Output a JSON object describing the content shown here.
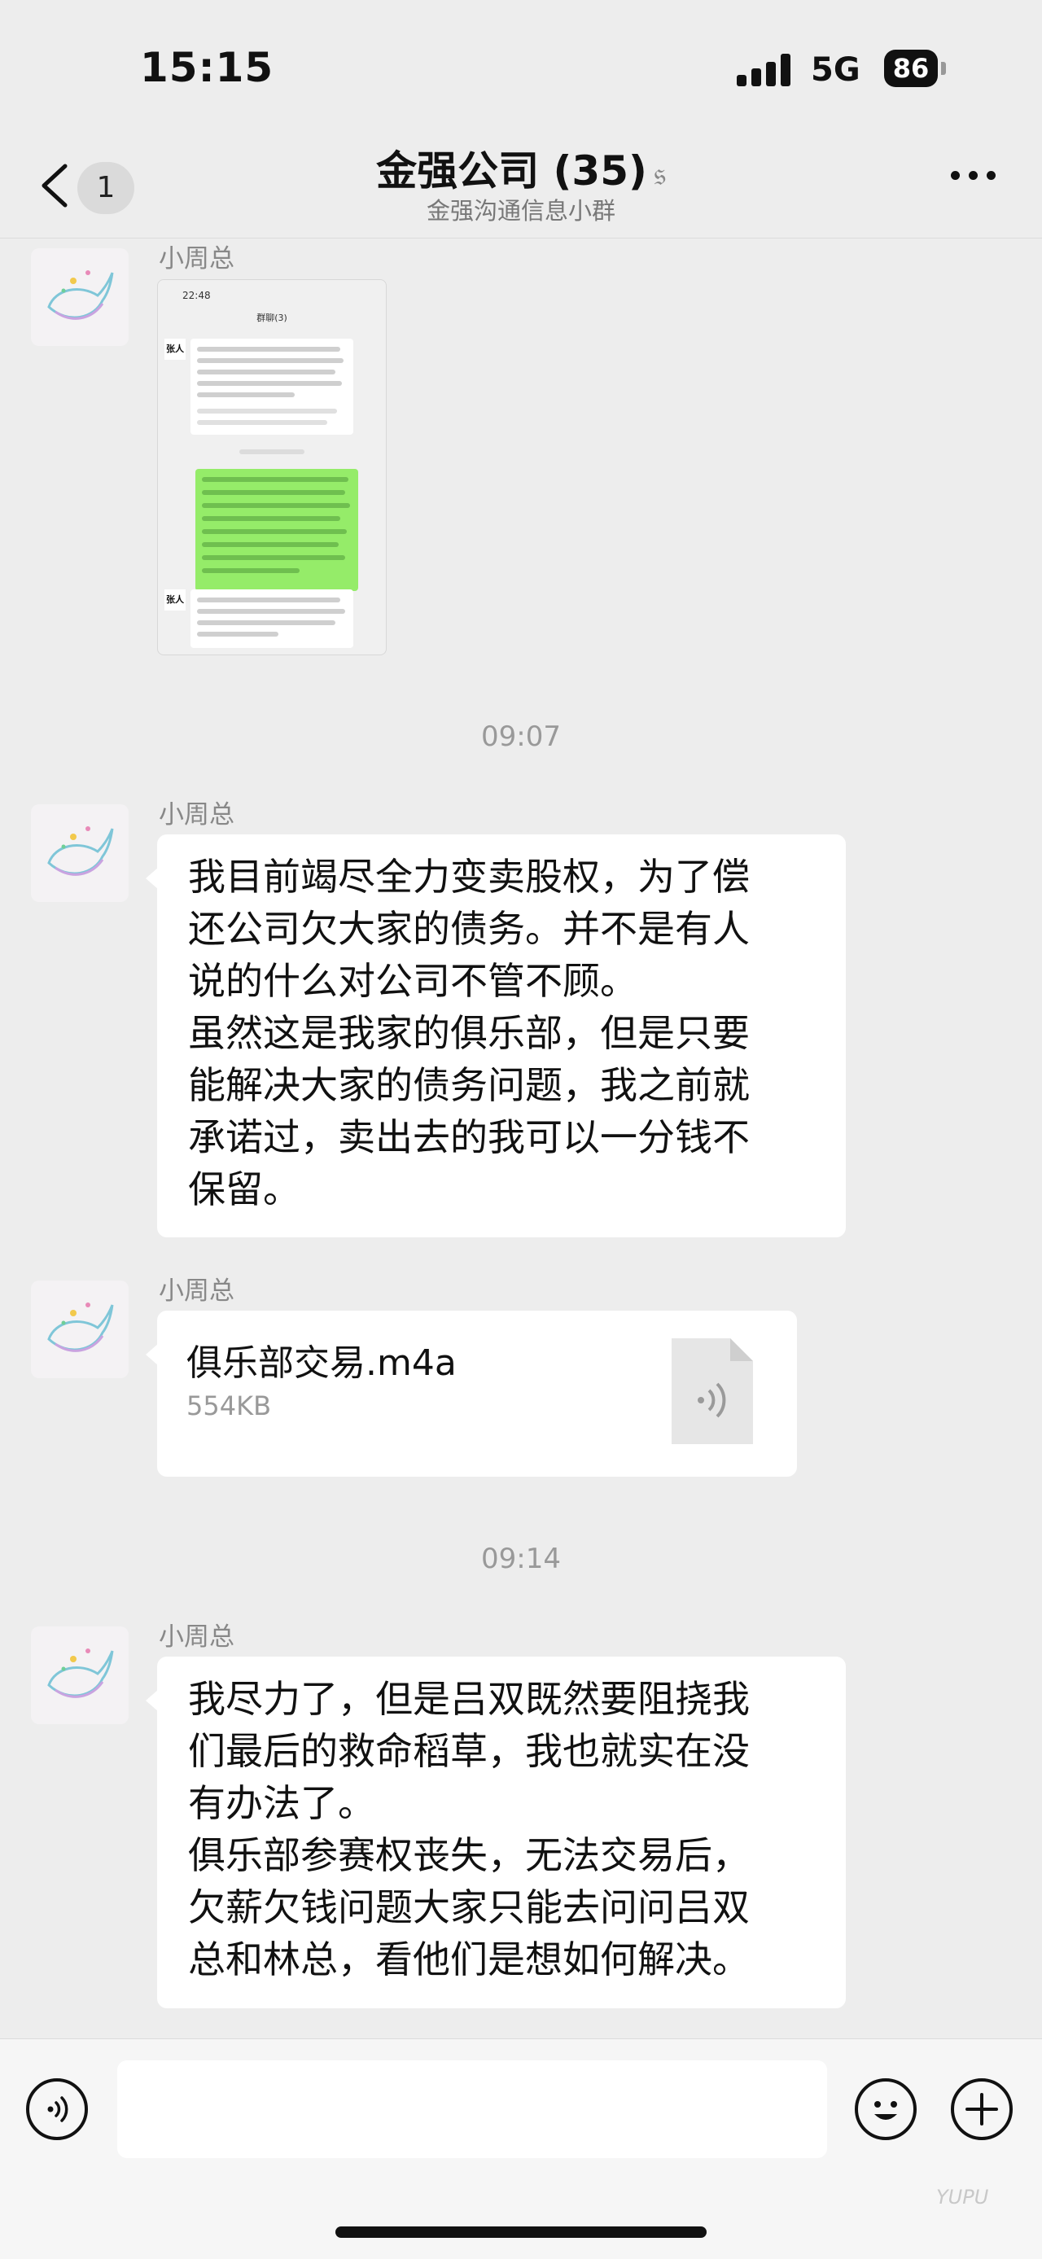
{
  "status": {
    "time": "15:15",
    "network": "5G",
    "battery": "86"
  },
  "nav": {
    "unread": "1",
    "title": "金强公司 (35)",
    "subtitle": "金强沟通信息小群"
  },
  "messages": {
    "m1": {
      "sender": "小周总"
    },
    "t1": "09:07",
    "m2": {
      "sender": "小周总",
      "text": "我目前竭尽全力变卖股权，为了偿\n还公司欠大家的债务。并不是有人\n说的什么对公司不管不顾。\n虽然这是我家的俱乐部，但是只要\n能解决大家的债务问题，我之前就\n承诺过，卖出去的我可以一分钱不\n保留。"
    },
    "m3": {
      "sender": "小周总",
      "file_name": "俱乐部交易.m4a",
      "file_size": "554KB"
    },
    "t2": "09:14",
    "m4": {
      "sender": "小周总",
      "text": "我尽力了，但是吕双既然要阻挠我\n们最后的救命稻草，我也就实在没\n有办法了。\n俱乐部参赛权丧失，无法交易后，\n欠薪欠钱问题大家只能去问问吕双\n总和林总，看他们是想如何解决。"
    }
  },
  "screenshot": {
    "time": "22:48",
    "title": "群聊(3)",
    "avatar_label": "张人"
  },
  "watermark": "YUPU"
}
